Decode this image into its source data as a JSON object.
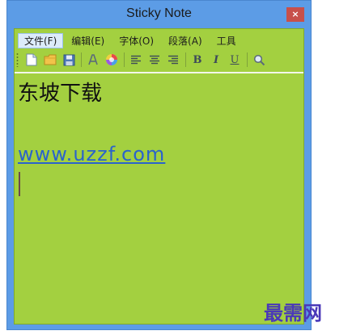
{
  "window": {
    "title": "Sticky Note",
    "close_label": "×"
  },
  "menu": [
    {
      "label": "文件(F)",
      "active": true
    },
    {
      "label": "编辑(E)"
    },
    {
      "label": "字体(O)"
    },
    {
      "label": "段落(A)"
    },
    {
      "label": "工具"
    }
  ],
  "toolbar": {
    "buttons": [
      {
        "name": "new-file-icon"
      },
      {
        "name": "open-folder-icon"
      },
      {
        "name": "save-icon"
      },
      {
        "name": "font-icon"
      },
      {
        "name": "color-picker-icon"
      },
      {
        "name": "align-left-icon"
      },
      {
        "name": "align-center-icon"
      },
      {
        "name": "align-right-icon"
      },
      {
        "name": "bold-icon",
        "label": "B"
      },
      {
        "name": "italic-icon",
        "label": "I"
      },
      {
        "name": "underline-icon",
        "label": "U"
      },
      {
        "name": "search-icon"
      }
    ]
  },
  "editor": {
    "line1": "东坡下载",
    "link": "www.uzzf.com"
  },
  "watermark": "最需网",
  "colors": {
    "frame": "#5c9ce6",
    "note_background": "#a3d040",
    "link": "#2a63cc",
    "close": "#c7504a"
  }
}
